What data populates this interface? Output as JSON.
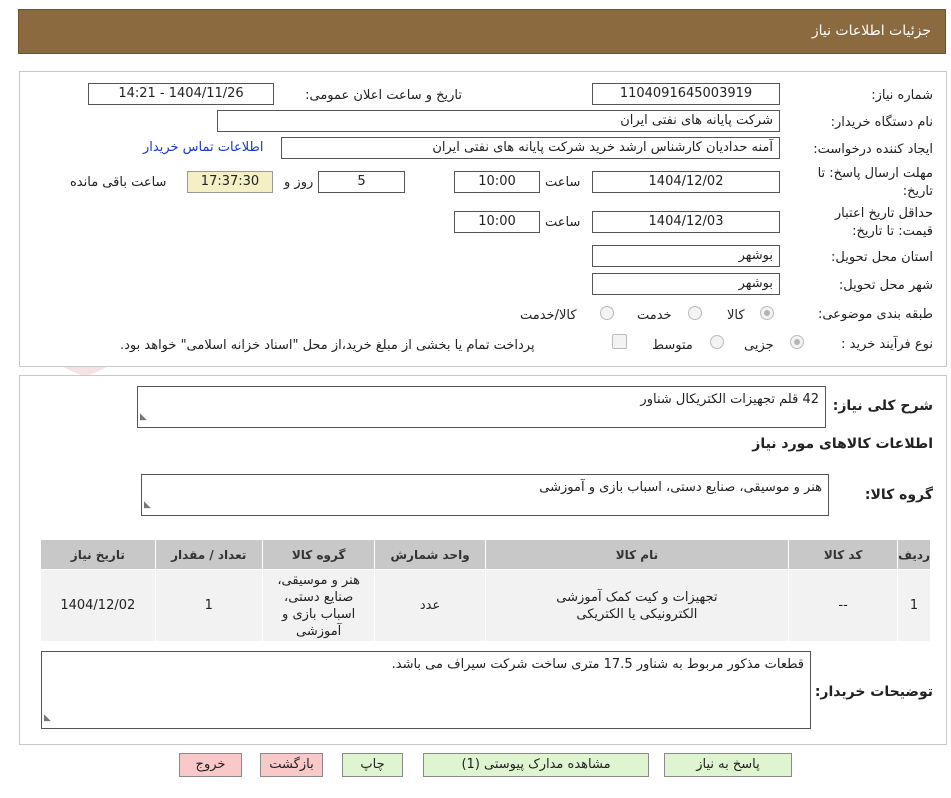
{
  "header": {
    "title": "جزئیات اطلاعات نیاز"
  },
  "form": {
    "need_number_label": "شماره نیاز:",
    "need_number": "1104091645003919",
    "announce_label": "تاریخ و ساعت اعلان عمومی:",
    "announce_value": "1404/11/26 - 14:21",
    "buyer_org_label": "نام دستگاه خریدار:",
    "buyer_org": "شرکت پایانه های نفتی ایران",
    "creator_label": "ایجاد کننده درخواست:",
    "creator": "آمنه  حدادیان  کارشناس ارشد خرید  شرکت پایانه های نفتی ایران",
    "contact_link": "اطلاعات تماس خریدار",
    "deadline_label_1": "مهلت ارسال پاسخ: تا",
    "deadline_label_2": "تاریخ:",
    "deadline_date": "1404/12/02",
    "time_label": "ساعت",
    "deadline_time": "10:00",
    "days_value": "5",
    "days_label": "روز و",
    "remaining_time": "17:37:30",
    "remaining_label": "ساعت باقی مانده",
    "validity_label_1": "حداقل تاریخ اعتبار",
    "validity_label_2": "قیمت: تا تاریخ:",
    "validity_date": "1404/12/03",
    "validity_time": "10:00",
    "province_label": "استان محل تحویل:",
    "province": "بوشهر",
    "city_label": "شهر محل تحویل:",
    "city": "بوشهر",
    "category_label": "طبقه بندی موضوعی:",
    "category_options": [
      "کالا",
      "خدمت",
      "کالا/خدمت"
    ],
    "process_label": "نوع فرآیند خرید :",
    "process_options": [
      "جزیی",
      "متوسط"
    ],
    "payment_note": "پرداخت تمام یا بخشی از مبلغ خرید،از محل \"اسناد خزانه اسلامی\" خواهد بود."
  },
  "summary": {
    "description_label": "شرح کلی نیاز:",
    "description": "42 قلم تجهیزات الکتریکال شناور",
    "goods_info_title": "اطلاعات کالاهای مورد نیاز",
    "goods_group_label": "گروه کالا:",
    "goods_group": "هنر و موسیقی، صنایع دستی، اسباب بازی و آموزشی"
  },
  "table": {
    "headers": [
      "ردیف",
      "کد کالا",
      "نام کالا",
      "واحد شمارش",
      "گروه کالا",
      "تعداد / مقدار",
      "تاریخ نیاز"
    ],
    "rows": [
      [
        "1",
        "--",
        "تجهیزات و کیت کمک آموزشی الکترونیکی یا الکتریکی",
        "عدد",
        "هنر و موسیقی، صنایع دستی، اسباب بازی و آموزشی",
        "1",
        "1404/12/02"
      ]
    ]
  },
  "buyer_notes": {
    "label": "توضیحات خریدار:",
    "text": "قطعات مذکور مربوط به شناور 17.5 متری ساخت شرکت سیراف می باشد."
  },
  "buttons": {
    "reply": "پاسخ به نیاز",
    "attachments": "مشاهده مدارک پیوستی (1)",
    "print": "چاپ",
    "back": "بازگشت",
    "exit": "خروج"
  },
  "watermark": {
    "text": "AriaTender.neT"
  },
  "colors": {
    "header": "#8b6a3f",
    "timer_bg": "#f5efc6",
    "link": "#1a37c8",
    "btn_green": "#dff5d2",
    "btn_pink": "#f9c9c9"
  }
}
